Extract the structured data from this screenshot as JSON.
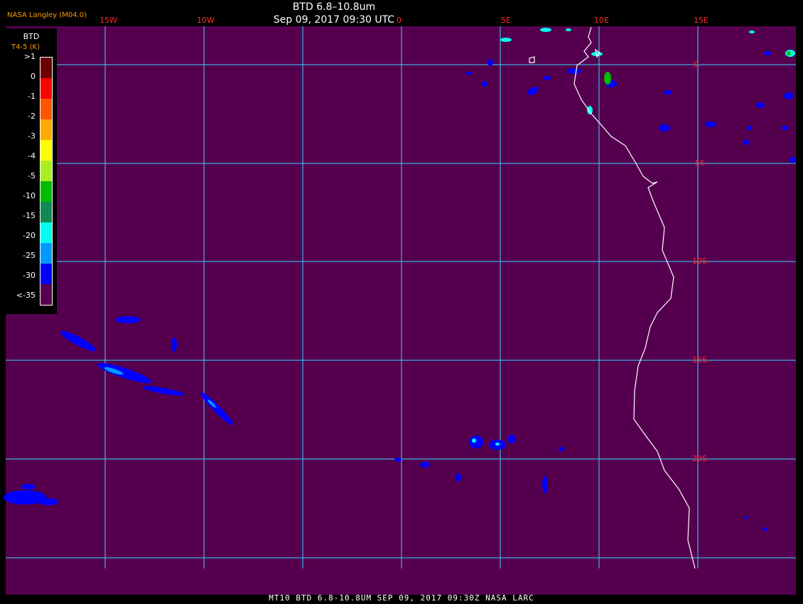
{
  "header": {
    "title": "BTD 6.8–10.8um",
    "datetime": "Sep 09, 2017 09:30 UTC",
    "credit": "NASA Langley (M04.0)"
  },
  "legend": {
    "title": "BTD",
    "subtitle": "T4-5 (K)",
    "labels": [
      ">1",
      "0",
      "-1",
      "-2",
      "-3",
      "-4",
      "-5",
      "-10",
      "-15",
      "-20",
      "-25",
      "-30",
      "<-35"
    ],
    "colors": [
      "#6a0000",
      "#ff0000",
      "#ff5500",
      "#ffaa00",
      "#ffff00",
      "#aaee22",
      "#00bb00",
      "#118855",
      "#00ffee",
      "#0099ff",
      "#0000ff",
      "#55004f"
    ]
  },
  "grid": {
    "longitude_labels": [
      "15W",
      "10W",
      "0",
      "5E",
      "10E",
      "15E"
    ],
    "latitude_labels": [
      "0",
      "5S",
      "10S",
      "15S",
      "20S"
    ]
  },
  "colors": {
    "background": "#55004f",
    "grid": "#33d6ff",
    "coast": "#ffffff",
    "label": "#ff2a2a"
  },
  "footer": "MT10  BTD 6.8-10.8UM   SEP 09, 2017 09:30Z   NASA LARC"
}
